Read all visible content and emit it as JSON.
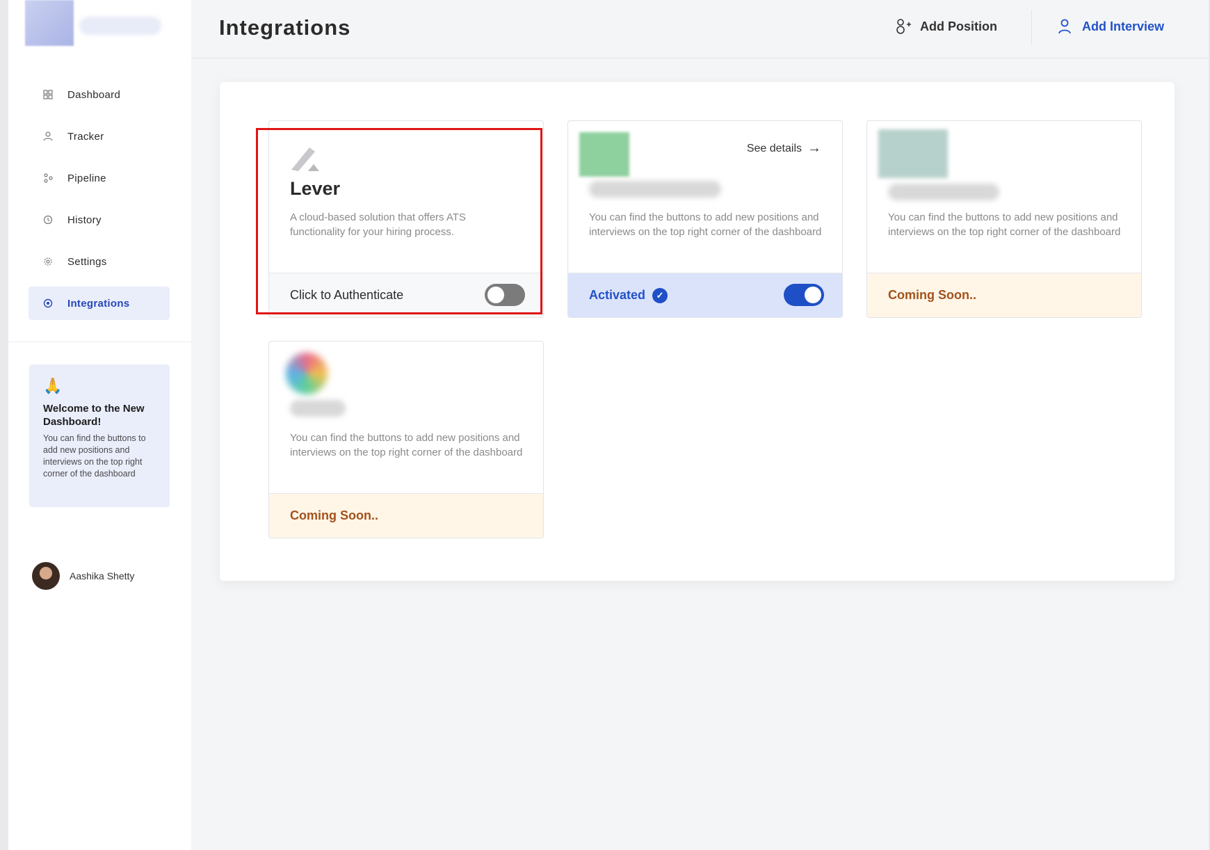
{
  "sidebar": {
    "items": [
      {
        "label": "Dashboard",
        "icon": "dashboard-icon",
        "active": false
      },
      {
        "label": "Tracker",
        "icon": "tracker-icon",
        "active": false
      },
      {
        "label": "Pipeline",
        "icon": "pipeline-icon",
        "active": false
      },
      {
        "label": "History",
        "icon": "history-icon",
        "active": false
      },
      {
        "label": "Settings",
        "icon": "settings-icon",
        "active": false
      },
      {
        "label": "Integrations",
        "icon": "integrations-icon",
        "active": true
      }
    ],
    "welcome": {
      "title": "Welcome to the New Dashboard!",
      "text": "You can find the buttons to add new positions and interviews on the top right corner of the dashboard"
    },
    "user": {
      "name": "Aashika Shetty"
    }
  },
  "header": {
    "title": "Integrations",
    "add_position": "Add Position",
    "add_interview": "Add Interview"
  },
  "cards": [
    {
      "name": "Lever",
      "description": "A cloud-based solution that offers ATS functionality for your hiring process.",
      "footer": "Click to Authenticate",
      "toggle_on": false
    },
    {
      "description": "You can find the buttons to add new positions and interviews on the top right corner of the dashboard",
      "footer": "Activated",
      "see_details": "See details",
      "toggle_on": true
    },
    {
      "description": "You can find the buttons to add new positions and interviews on the top right corner of the dashboard",
      "footer": "Coming Soon.."
    },
    {
      "description": "You can find the buttons to add new positions and interviews on the top right corner of the dashboard",
      "footer": "Coming Soon.."
    }
  ],
  "colors": {
    "accent": "#2152c8",
    "active_bg": "#eaeefb",
    "soon_bg": "#fff6e8",
    "soon_text": "#a2521c",
    "highlight": "#e01515"
  }
}
